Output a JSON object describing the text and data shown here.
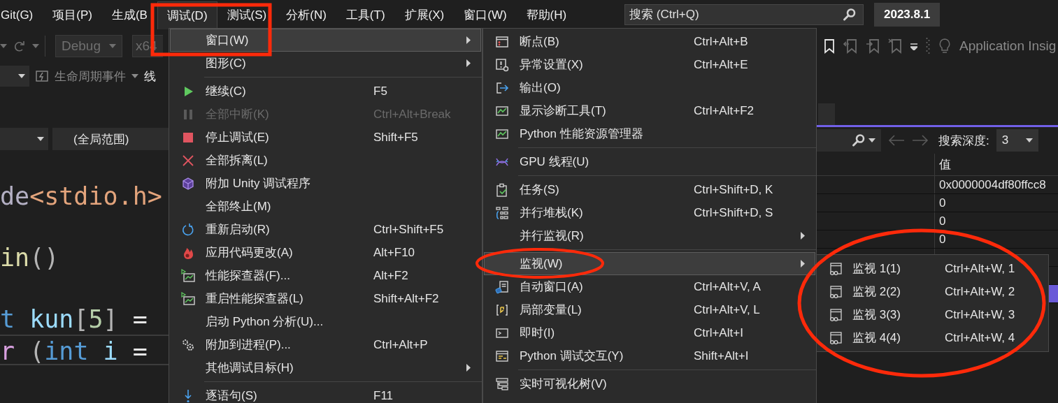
{
  "menu_bar": {
    "items": [
      {
        "label": "Git(G)",
        "selected": false
      },
      {
        "label": "项目(P)",
        "selected": false
      },
      {
        "label": "生成(B",
        "selected": false
      },
      {
        "label": "调试(D)",
        "selected": true
      },
      {
        "label": "测试(S)",
        "selected": false
      },
      {
        "label": "分析(N)",
        "selected": false
      },
      {
        "label": "工具(T)",
        "selected": false
      },
      {
        "label": "扩展(X)",
        "selected": false
      },
      {
        "label": "窗口(W)",
        "selected": false
      },
      {
        "label": "帮助(H)",
        "selected": false
      }
    ],
    "search": {
      "placeholder": "搜索 (Ctrl+Q)"
    },
    "solution_name": "2023.8.1"
  },
  "toolbar": {
    "configuration": "Debug",
    "platform": "x64",
    "event_label": "生命周期事件",
    "cut_label": "线",
    "insights_label": "Application Insig"
  },
  "navigation": {
    "scope": "(全局范围)"
  },
  "code_lines": [
    {
      "current": false,
      "tokens": [
        {
          "text": "de",
          "kind": "preprocessor"
        },
        {
          "text": "<stdio.h>",
          "kind": "string"
        }
      ]
    },
    {
      "current": false,
      "tokens": [
        {
          "text": "in",
          "kind": "function"
        },
        {
          "text": "()",
          "kind": "punctuation"
        }
      ]
    },
    {
      "current": false,
      "tokens": [
        {
          "text": "t",
          "kind": "keyword"
        },
        {
          "text": " kun",
          "kind": "variable"
        },
        {
          "text": "[",
          "kind": "punctuation"
        },
        {
          "text": "5",
          "kind": "number"
        },
        {
          "text": "]",
          "kind": "punctuation"
        },
        {
          "text": " =",
          "kind": "operator"
        }
      ]
    },
    {
      "current": true,
      "tokens": [
        {
          "text": "r",
          "kind": "control"
        },
        {
          "text": " (",
          "kind": "punctuation"
        },
        {
          "text": "int",
          "kind": "keyword"
        },
        {
          "text": " i",
          "kind": "variable"
        },
        {
          "text": " =",
          "kind": "operator"
        }
      ]
    }
  ],
  "watch": {
    "search_depth_label": "搜索深度:",
    "search_depth": "3",
    "value_header": "值",
    "rows": [
      {
        "value": "0x0000004df80ffcc8",
        "selected": false
      },
      {
        "value": "0",
        "selected": false
      },
      {
        "value": "0",
        "selected": false
      },
      {
        "value": "0",
        "selected": false
      },
      {
        "selected": false
      },
      {
        "selected": false
      },
      {
        "selected": true
      }
    ]
  },
  "debug_menu": {
    "items": [
      {
        "kind": "item",
        "label": "窗口(W)",
        "submenu": true,
        "selected": true,
        "disabled": false
      },
      {
        "kind": "item",
        "label": "图形(C)",
        "submenu": true,
        "selected": false,
        "disabled": false
      },
      {
        "kind": "separator"
      },
      {
        "kind": "item",
        "label": "继续(C)",
        "shortcut": "F5",
        "submenu": false,
        "selected": false,
        "disabled": false
      },
      {
        "kind": "item",
        "label": "全部中断(K)",
        "shortcut": "Ctrl+Alt+Break",
        "submenu": false,
        "selected": false,
        "disabled": true
      },
      {
        "kind": "item",
        "label": "停止调试(E)",
        "shortcut": "Shift+F5",
        "submenu": false,
        "selected": false,
        "disabled": false
      },
      {
        "kind": "item",
        "label": "全部拆离(L)",
        "submenu": false,
        "selected": false,
        "disabled": false
      },
      {
        "kind": "item",
        "label": "附加 Unity 调试程序",
        "submenu": false,
        "selected": false,
        "disabled": false
      },
      {
        "kind": "item",
        "label": "全部终止(M)",
        "submenu": false,
        "selected": false,
        "disabled": false
      },
      {
        "kind": "item",
        "label": "重新启动(R)",
        "shortcut": "Ctrl+Shift+F5",
        "submenu": false,
        "selected": false,
        "disabled": false
      },
      {
        "kind": "item",
        "label": "应用代码更改(A)",
        "shortcut": "Alt+F10",
        "submenu": false,
        "selected": false,
        "disabled": false
      },
      {
        "kind": "item",
        "label": "性能探查器(F)...",
        "shortcut": "Alt+F2",
        "submenu": false,
        "selected": false,
        "disabled": false
      },
      {
        "kind": "item",
        "label": "重启性能探查器(L)",
        "shortcut": "Shift+Alt+F2",
        "submenu": false,
        "selected": false,
        "disabled": false
      },
      {
        "kind": "item",
        "label": "启动 Python 分析(U)...",
        "submenu": false,
        "selected": false,
        "disabled": false
      },
      {
        "kind": "item",
        "label": "附加到进程(P)...",
        "shortcut": "Ctrl+Alt+P",
        "submenu": false,
        "selected": false,
        "disabled": false
      },
      {
        "kind": "item",
        "label": "其他调试目标(H)",
        "submenu": true,
        "selected": false,
        "disabled": false
      },
      {
        "kind": "separator"
      },
      {
        "kind": "item",
        "label": "逐语句(S)",
        "shortcut": "F11",
        "submenu": false,
        "selected": false,
        "disabled": false
      }
    ]
  },
  "window_submenu": {
    "items": [
      {
        "kind": "item",
        "label": "断点(B)",
        "shortcut": "Ctrl+Alt+B",
        "submenu": false,
        "selected": false,
        "disabled": false
      },
      {
        "kind": "item",
        "label": "异常设置(X)",
        "shortcut": "Ctrl+Alt+E",
        "submenu": false,
        "selected": false,
        "disabled": false
      },
      {
        "kind": "item",
        "label": "输出(O)",
        "submenu": false,
        "selected": false,
        "disabled": false
      },
      {
        "kind": "item",
        "label": "显示诊断工具(T)",
        "shortcut": "Ctrl+Alt+F2",
        "submenu": false,
        "selected": false,
        "disabled": false
      },
      {
        "kind": "item",
        "label": "Python 性能资源管理器",
        "submenu": false,
        "selected": false,
        "disabled": false
      },
      {
        "kind": "separator"
      },
      {
        "kind": "item",
        "label": "GPU 线程(U)",
        "submenu": false,
        "selected": false,
        "disabled": false
      },
      {
        "kind": "separator"
      },
      {
        "kind": "item",
        "label": "任务(S)",
        "shortcut": "Ctrl+Shift+D, K",
        "submenu": false,
        "selected": false,
        "disabled": false
      },
      {
        "kind": "item",
        "label": "并行堆栈(K)",
        "shortcut": "Ctrl+Shift+D, S",
        "submenu": false,
        "selected": false,
        "disabled": false
      },
      {
        "kind": "item",
        "label": "并行监视(R)",
        "submenu": true,
        "selected": false,
        "disabled": false
      },
      {
        "kind": "separator"
      },
      {
        "kind": "item",
        "label": "监视(W)",
        "submenu": true,
        "selected": true,
        "disabled": false
      },
      {
        "kind": "item",
        "label": "自动窗口(A)",
        "shortcut": "Ctrl+Alt+V, A",
        "submenu": false,
        "selected": false,
        "disabled": false
      },
      {
        "kind": "item",
        "label": "局部变量(L)",
        "shortcut": "Ctrl+Alt+V, L",
        "submenu": false,
        "selected": false,
        "disabled": false
      },
      {
        "kind": "item",
        "label": "即时(I)",
        "shortcut": "Ctrl+Alt+I",
        "submenu": false,
        "selected": false,
        "disabled": false
      },
      {
        "kind": "item",
        "label": "Python 调试交互(Y)",
        "shortcut": "Shift+Alt+I",
        "submenu": false,
        "selected": false,
        "disabled": false
      },
      {
        "kind": "separator"
      },
      {
        "kind": "item",
        "label": "实时可视化树(V)",
        "submenu": false,
        "selected": false,
        "disabled": false
      }
    ]
  },
  "watch_submenu": {
    "items": [
      {
        "kind": "item",
        "label": "监视 1(1)",
        "shortcut": "Ctrl+Alt+W, 1",
        "submenu": false,
        "selected": false,
        "disabled": false
      },
      {
        "kind": "item",
        "label": "监视 2(2)",
        "shortcut": "Ctrl+Alt+W, 2",
        "submenu": false,
        "selected": false,
        "disabled": false
      },
      {
        "kind": "item",
        "label": "监视 3(3)",
        "shortcut": "Ctrl+Alt+W, 3",
        "submenu": false,
        "selected": false,
        "disabled": false
      },
      {
        "kind": "item",
        "label": "监视 4(4)",
        "shortcut": "Ctrl+Alt+W, 4",
        "submenu": false,
        "selected": false,
        "disabled": false
      }
    ]
  }
}
